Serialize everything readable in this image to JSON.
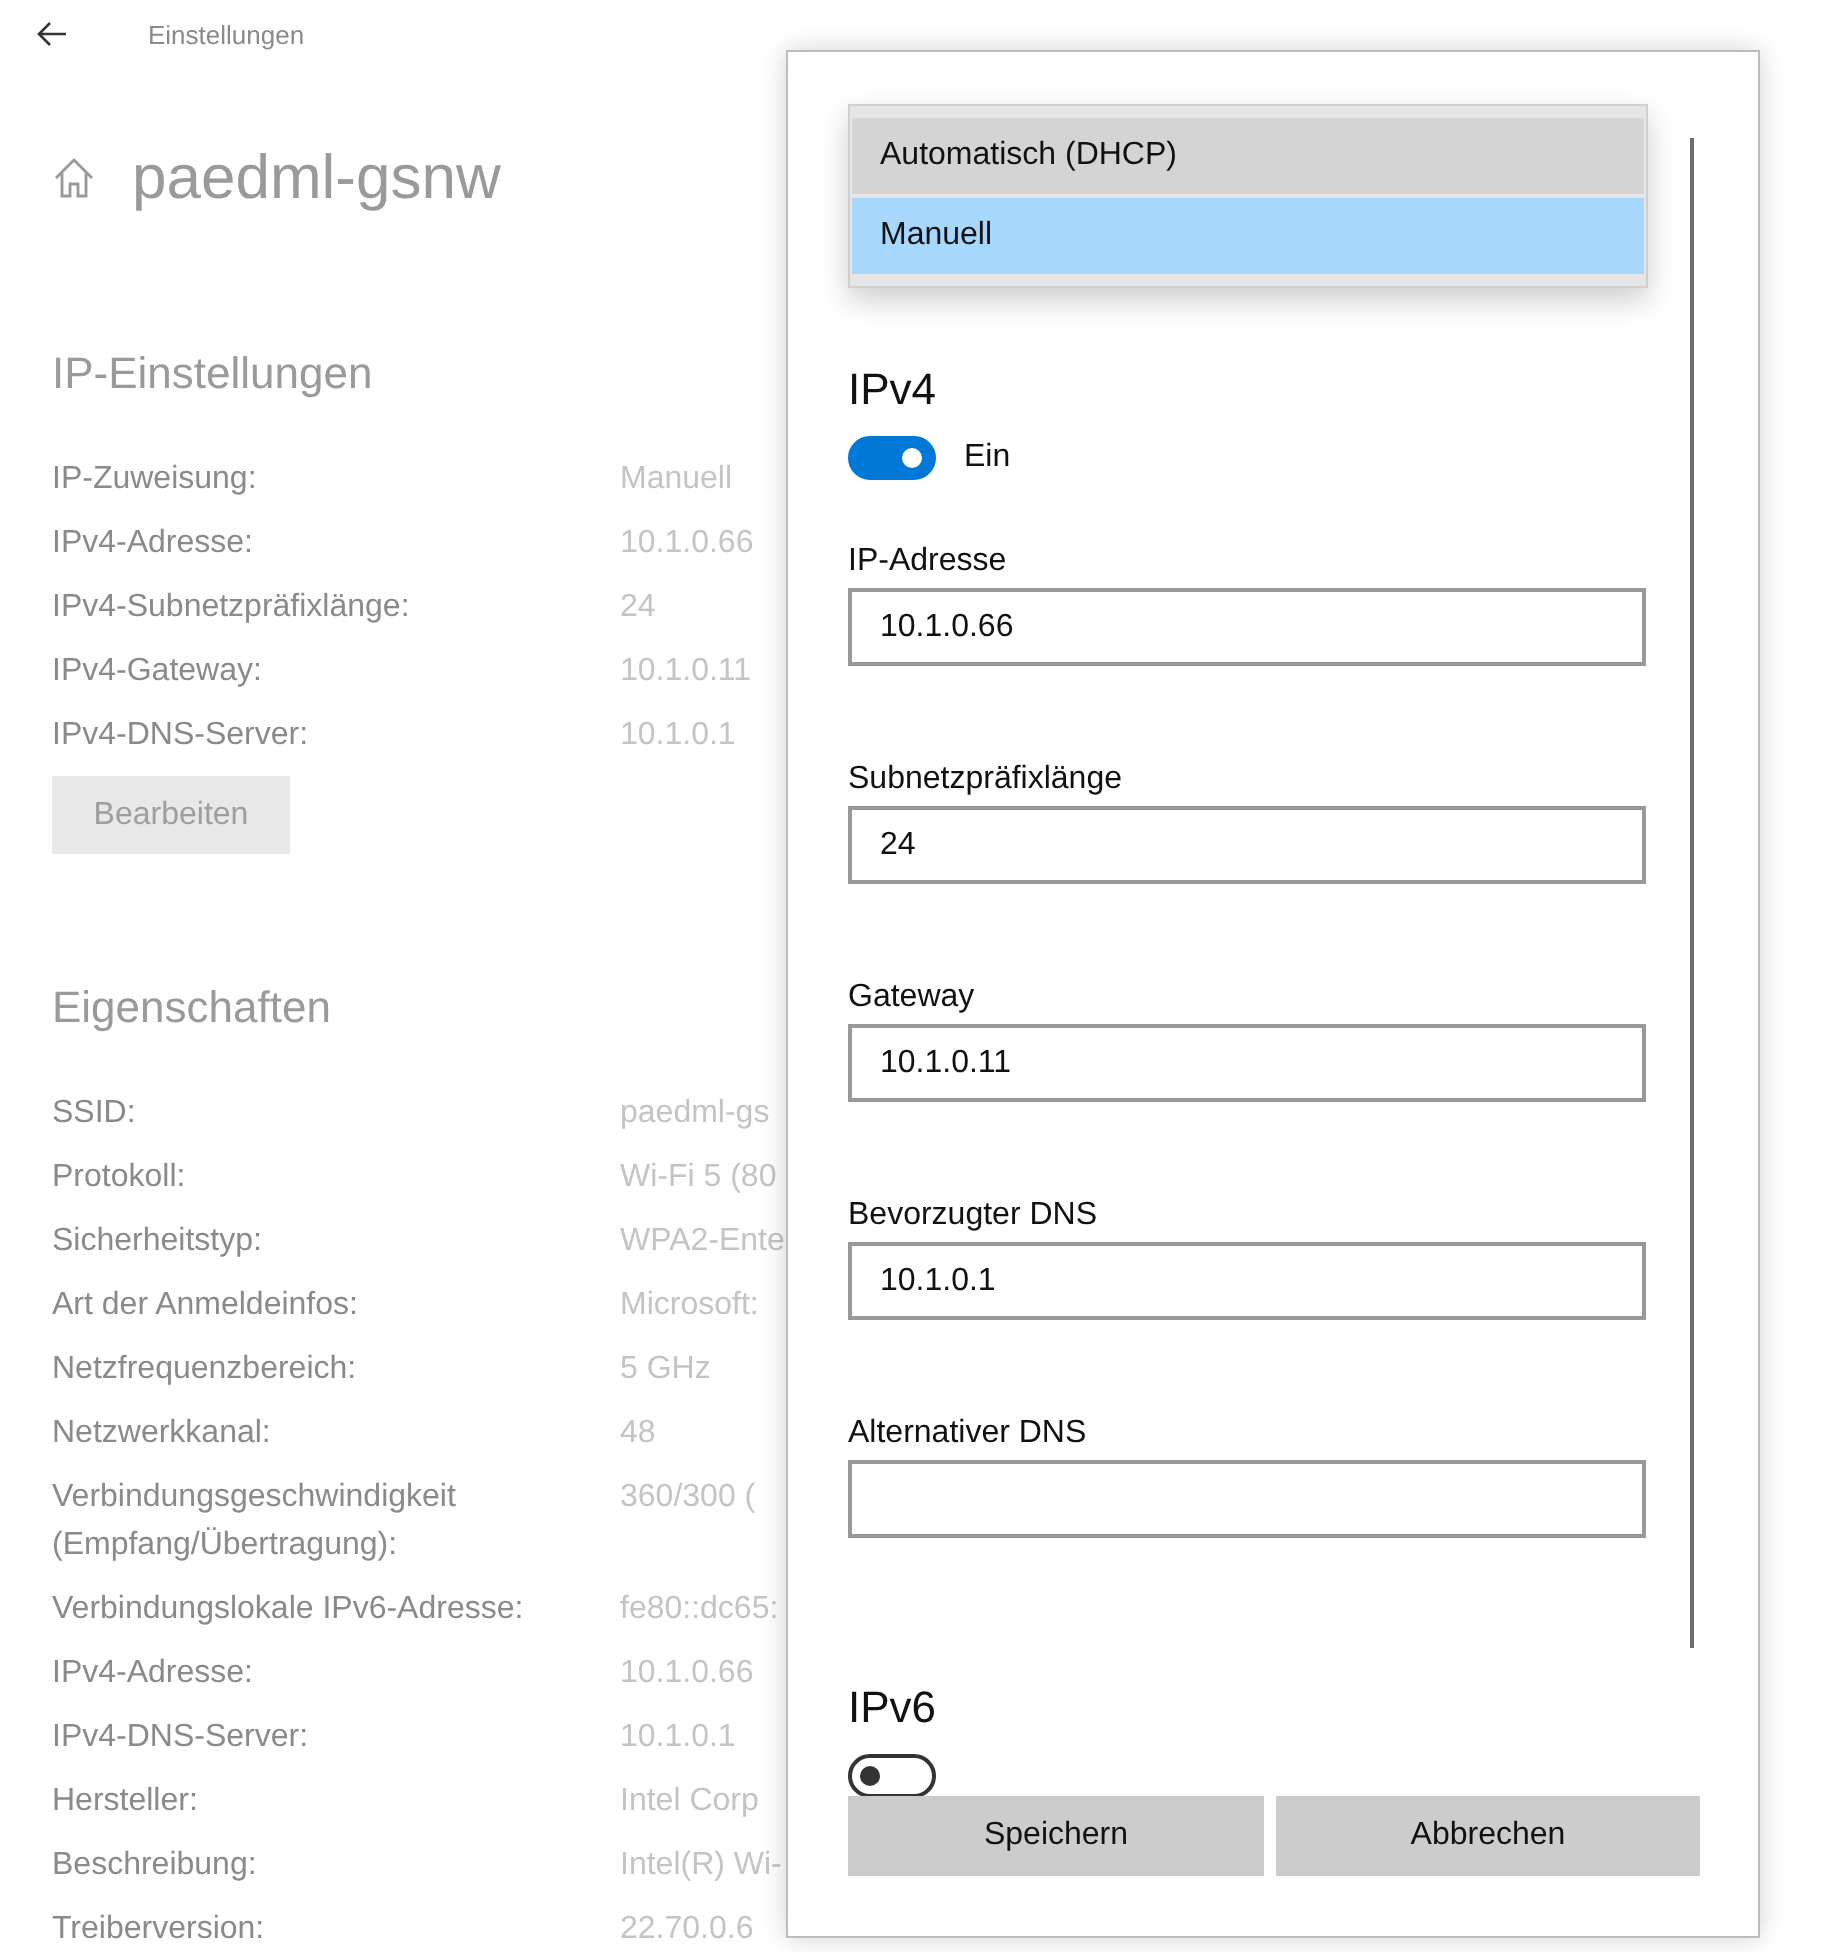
{
  "header": {
    "title": "Einstellungen"
  },
  "page": {
    "title": "paedml-gsnw"
  },
  "ip_settings": {
    "heading": "IP-Einstellungen",
    "rows": [
      {
        "label": "IP-Zuweisung:",
        "value": "Manuell"
      },
      {
        "label": "IPv4-Adresse:",
        "value": "10.1.0.66"
      },
      {
        "label": "IPv4-Subnetzpräfixlänge:",
        "value": "24"
      },
      {
        "label": "IPv4-Gateway:",
        "value": "10.1.0.11"
      },
      {
        "label": "IPv4-DNS-Server:",
        "value": "10.1.0.1"
      }
    ],
    "edit_button": "Bearbeiten"
  },
  "properties": {
    "heading": "Eigenschaften",
    "rows": [
      {
        "label": "SSID:",
        "value": "paedml-gs"
      },
      {
        "label": "Protokoll:",
        "value": "Wi-Fi 5 (80"
      },
      {
        "label": "Sicherheitstyp:",
        "value": "WPA2-Ente"
      },
      {
        "label": "Art der Anmeldeinfos:",
        "value": "Microsoft:"
      },
      {
        "label": "Netzfrequenzbereich:",
        "value": "5 GHz"
      },
      {
        "label": "Netzwerkkanal:",
        "value": "48"
      },
      {
        "label": "Verbindungsgeschwindigkeit (Empfang/Übertragung):",
        "value": "360/300 ("
      },
      {
        "label": "Verbindungslokale IPv6-Adresse:",
        "value": "fe80::dc65:"
      },
      {
        "label": "IPv4-Adresse:",
        "value": "10.1.0.66"
      },
      {
        "label": "IPv4-DNS-Server:",
        "value": "10.1.0.1"
      },
      {
        "label": "Hersteller:",
        "value": "Intel Corp"
      },
      {
        "label": "Beschreibung:",
        "value": "Intel(R) Wi-"
      },
      {
        "label": "Treiberversion:",
        "value": "22.70.0.6"
      }
    ]
  },
  "dialog": {
    "dropdown_options": [
      {
        "label": "Automatisch (DHCP)",
        "selected": false
      },
      {
        "label": "Manuell",
        "selected": true
      }
    ],
    "ipv4": {
      "heading": "IPv4",
      "on": true,
      "toggle_label": "Ein",
      "fields": [
        {
          "label": "IP-Adresse",
          "value": "10.1.0.66"
        },
        {
          "label": "Subnetzpräfixlänge",
          "value": "24"
        },
        {
          "label": "Gateway",
          "value": "10.1.0.11"
        },
        {
          "label": "Bevorzugter DNS",
          "value": "10.1.0.1"
        },
        {
          "label": "Alternativer DNS"
        }
      ]
    },
    "ipv6": {
      "heading": "IPv6",
      "on": false
    },
    "buttons": [
      "Speichern",
      "Abbrechen"
    ]
  }
}
